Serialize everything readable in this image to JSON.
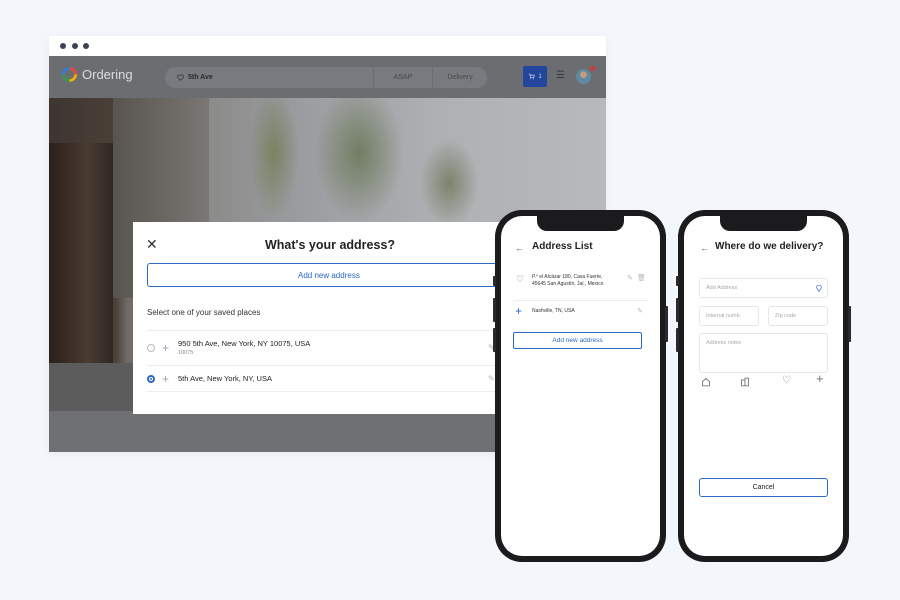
{
  "browser": {
    "header": {
      "logo_text": "Ordering",
      "search_address": "5th Ave",
      "time_option": "ASAP",
      "delivery_option": "Delivery",
      "cart_count": "1"
    }
  },
  "modal": {
    "title": "What's your address?",
    "add_button": "Add new address",
    "subtitle": "Select one of your saved places",
    "addresses": [
      {
        "address": "950 5th Ave, New York, NY 10075, USA",
        "zip": "10075",
        "selected": false
      },
      {
        "address": "5th Ave, New York, NY, USA",
        "zip": "",
        "selected": true
      }
    ]
  },
  "phone_address_list": {
    "title": "Address List",
    "items": [
      {
        "address_line1": "P.º el Alcázar 180, Casa Fuerte,",
        "address_line2": "45645 San Agustín, Jal., Mexico"
      },
      {
        "address_line1": "Nashville, TN, USA",
        "address_line2": ""
      }
    ],
    "add_button": "Add new address"
  },
  "phone_delivery": {
    "title": "Where do we delivery?",
    "address_placeholder": "Add Address",
    "internal_number_placeholder": "Internal numb",
    "zip_placeholder": "Zip code",
    "notes_placeholder": "Address notes",
    "cancel_button": "Cancel"
  },
  "colors": {
    "accent": "#2c68c8",
    "cart_button": "#24459c",
    "background": "#f3f6fb"
  }
}
